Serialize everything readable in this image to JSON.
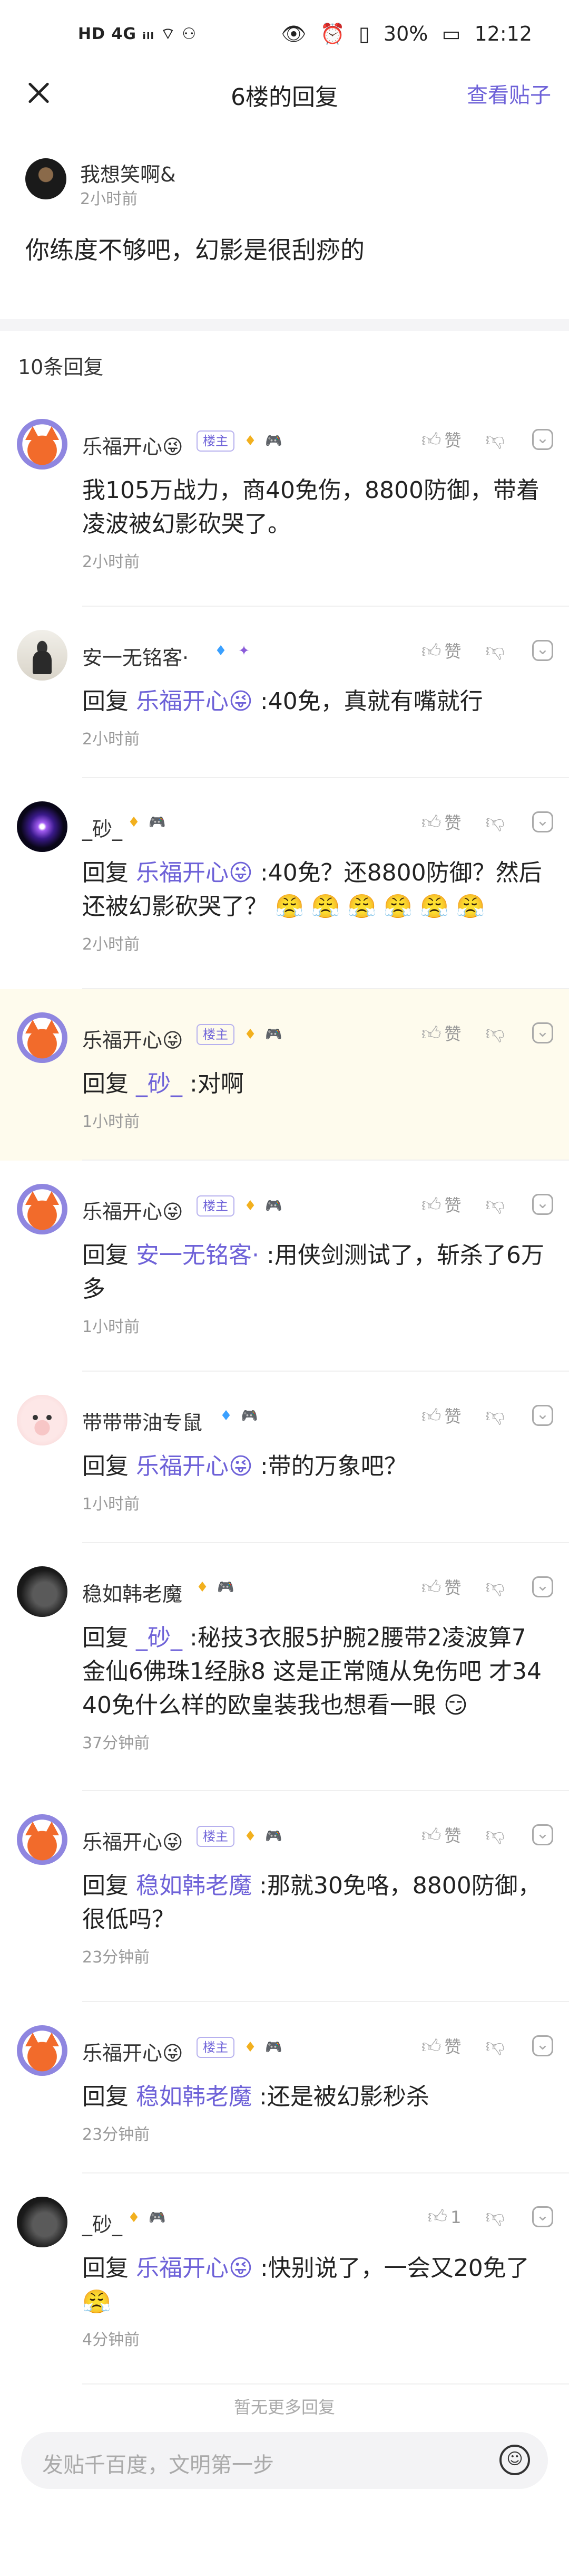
{
  "status_bar": {
    "left": "HD 4G ᵢₗₗ ⌔ ⚇",
    "right_icons": [
      "👁",
      "⏰",
      "▯"
    ],
    "battery": "30%",
    "time": "12:12"
  },
  "header": {
    "title": "6楼的回复",
    "view_post": "查看贴子"
  },
  "main_post": {
    "user": "我想笑啊&",
    "time": "2小时前",
    "text": "你练度不够吧，幻影是很刮痧的"
  },
  "reply_count": "10条回复",
  "host_badge": "楼主",
  "reply_prefix": "回复",
  "replies": [
    {
      "user": "乐福开心😜",
      "time": "2小时前",
      "mention": "",
      "text": "我105万战力，商40免伤，8800防御，带着凌波被幻影砍哭了。",
      "like": "赞"
    },
    {
      "user": "安一无铭客·",
      "time": "2小时前",
      "mention": "乐福开心😜",
      "text": ":40免，真就有嘴就行",
      "like": "赞"
    },
    {
      "user": "_砂_",
      "time": "2小时前",
      "mention": "乐福开心😜",
      "text": ":40免？还8800防御？然后还被幻影砍哭了？ 😤 😤 😤 😤 😤 😤",
      "like": "赞"
    },
    {
      "user": "乐福开心😜",
      "time": "1小时前",
      "mention": "_砂_",
      "text": ":对啊",
      "like": "赞"
    },
    {
      "user": "乐福开心😜",
      "time": "1小时前",
      "mention": "安一无铭客·",
      "text": ":用侠剑测试了，斩杀了6万多",
      "like": "赞"
    },
    {
      "user": "带带带油专鼠",
      "time": "1小时前",
      "mention": "乐福开心😜",
      "text": ":带的万象吧？",
      "like": "赞"
    },
    {
      "user": "稳如韩老魔",
      "time": "37分钟前",
      "mention": "_砂_",
      "text": ":秘技3衣服5护腕2腰带2凌波算7金仙6佛珠1经脉8 这是正常随从免伤吧 才34 40免什么样的欧皇装我也想看一眼 😏",
      "like": "赞"
    },
    {
      "user": "乐福开心😜",
      "time": "23分钟前",
      "mention": "稳如韩老魔",
      "text": ":那就30免咯，8800防御，很低吗？",
      "like": "赞"
    },
    {
      "user": "乐福开心😜",
      "time": "23分钟前",
      "mention": "稳如韩老魔",
      "text": ":还是被幻影秒杀",
      "like": "赞"
    },
    {
      "user": "_砂_",
      "time": "4分钟前",
      "mention": "乐福开心😜",
      "text": ":快别说了，一会又20免了 😤",
      "like": "1"
    }
  ],
  "no_more": "暂无更多回复",
  "input": {
    "placeholder": "发贴千百度，文明第一步"
  },
  "colors": {
    "accent": "#6e62d8",
    "highlight_bg": "#fefbed"
  },
  "icons": {
    "close": "close-icon",
    "like": "thumb-up-icon",
    "dislike": "thumb-down-icon",
    "more": "more-icon",
    "emoji": "emoji-icon"
  }
}
